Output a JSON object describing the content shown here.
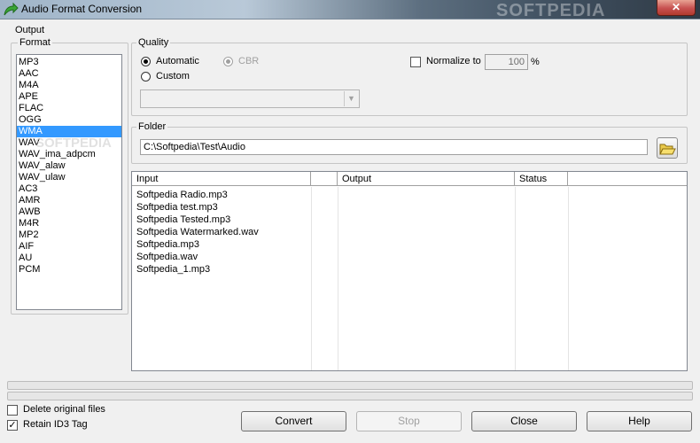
{
  "window": {
    "title": "Audio Format Conversion",
    "close_glyph": "✕",
    "watermark": "SOFTPEDIA"
  },
  "output_group": {
    "label": "Output"
  },
  "format_group": {
    "label": "Format",
    "items": [
      "MP3",
      "AAC",
      "M4A",
      "APE",
      "FLAC",
      "OGG",
      "WMA",
      "WAV",
      "WAV_ima_adpcm",
      "WAV_alaw",
      "WAV_ulaw",
      "AC3",
      "AMR",
      "AWB",
      "M4R",
      "MP2",
      "AIF",
      "AU",
      "PCM"
    ],
    "selected": "WMA"
  },
  "quality_group": {
    "label": "Quality",
    "automatic_label": "Automatic",
    "cbr_label": "CBR",
    "custom_label": "Custom",
    "normalize_label": "Normalize to",
    "normalize_value": "100",
    "normalize_unit": "%",
    "combo_value": ""
  },
  "folder_group": {
    "label": "Folder",
    "path": "C:\\Softpedia\\Test\\Audio"
  },
  "file_list": {
    "columns": [
      "Input",
      "",
      "Output",
      "Status"
    ],
    "rows": [
      "Softpedia Radio.mp3",
      "Softpedia test.mp3",
      "Softpedia Tested.mp3",
      "Softpedia Watermarked.wav",
      "Softpedia.mp3",
      "Softpedia.wav",
      "Softpedia_1.mp3"
    ]
  },
  "options": {
    "delete_original_label": "Delete original files",
    "delete_original_checked": false,
    "retain_id3_label": "Retain ID3 Tag",
    "retain_id3_checked": true,
    "check_glyph": "✓"
  },
  "buttons": {
    "convert": "Convert",
    "stop": "Stop",
    "close": "Close",
    "help": "Help"
  },
  "icons": {
    "app": "green-arrow-icon",
    "folder": "open-folder-icon"
  }
}
